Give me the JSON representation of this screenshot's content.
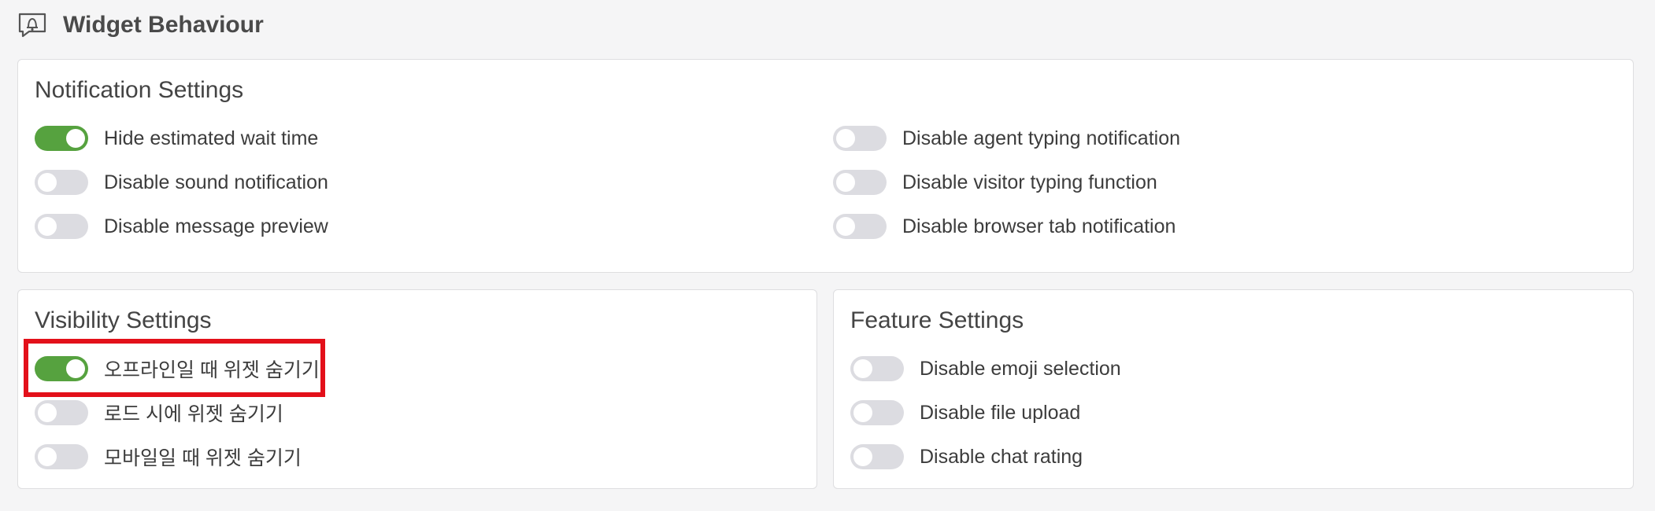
{
  "header": {
    "title": "Widget Behaviour",
    "icon": "chat-bell-icon"
  },
  "notification": {
    "title": "Notification Settings",
    "items": [
      {
        "label": "Hide estimated wait time",
        "on": true
      },
      {
        "label": "Disable sound notification",
        "on": false
      },
      {
        "label": "Disable message preview",
        "on": false
      },
      {
        "label": "Disable agent typing notification",
        "on": false
      },
      {
        "label": "Disable visitor typing function",
        "on": false
      },
      {
        "label": "Disable browser tab notification",
        "on": false
      }
    ]
  },
  "visibility": {
    "title": "Visibility Settings",
    "items": [
      {
        "label": "오프라인일 때 위젯 숨기기",
        "on": true
      },
      {
        "label": "로드 시에 위젯 숨기기",
        "on": false
      },
      {
        "label": "모바일일 때 위젯 숨기기",
        "on": false
      }
    ]
  },
  "feature": {
    "title": "Feature Settings",
    "items": [
      {
        "label": "Disable emoji selection",
        "on": false
      },
      {
        "label": "Disable file upload",
        "on": false
      },
      {
        "label": "Disable chat rating",
        "on": false
      }
    ]
  },
  "colors": {
    "toggle_on": "#56a23f",
    "toggle_off": "#dcdce1",
    "highlight": "#e3101a",
    "background": "#f5f5f6"
  }
}
